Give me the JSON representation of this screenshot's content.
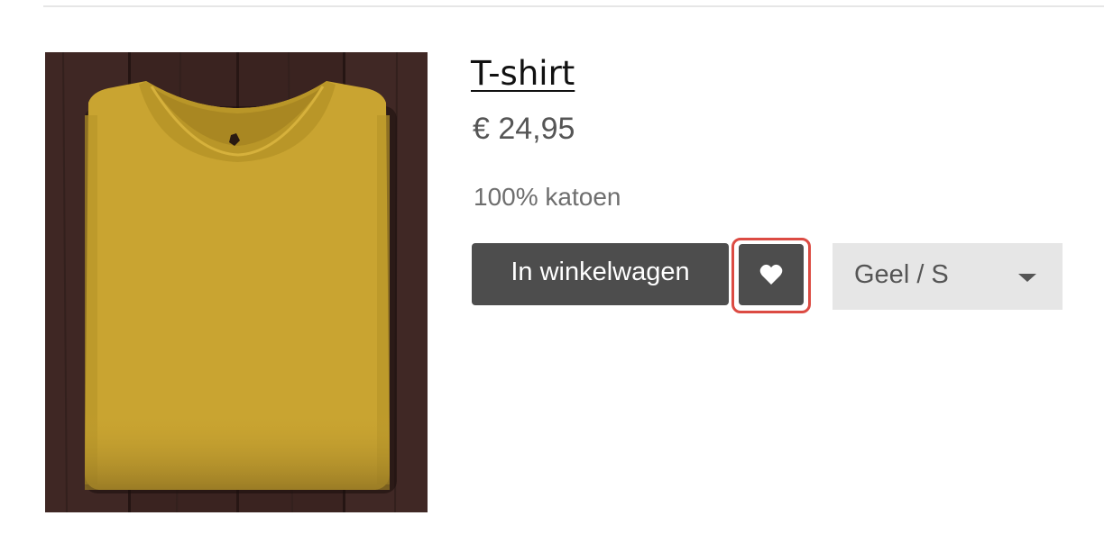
{
  "product": {
    "title": "T-shirt",
    "price": "€ 24,95",
    "description": "100% katoen",
    "image_icon": "yellow-tshirt-image"
  },
  "actions": {
    "add_to_cart_label": "In winkelwagen",
    "wishlist_icon": "heart-icon",
    "variant_selected": "Geel / S",
    "variant_chevron_icon": "chevron-down-icon"
  },
  "colors": {
    "button_bg": "#4d4d4d",
    "highlight": "#dc4b43",
    "select_bg": "#e6e6e6",
    "shirt": "#c9a431",
    "wood": "#3b2421"
  }
}
